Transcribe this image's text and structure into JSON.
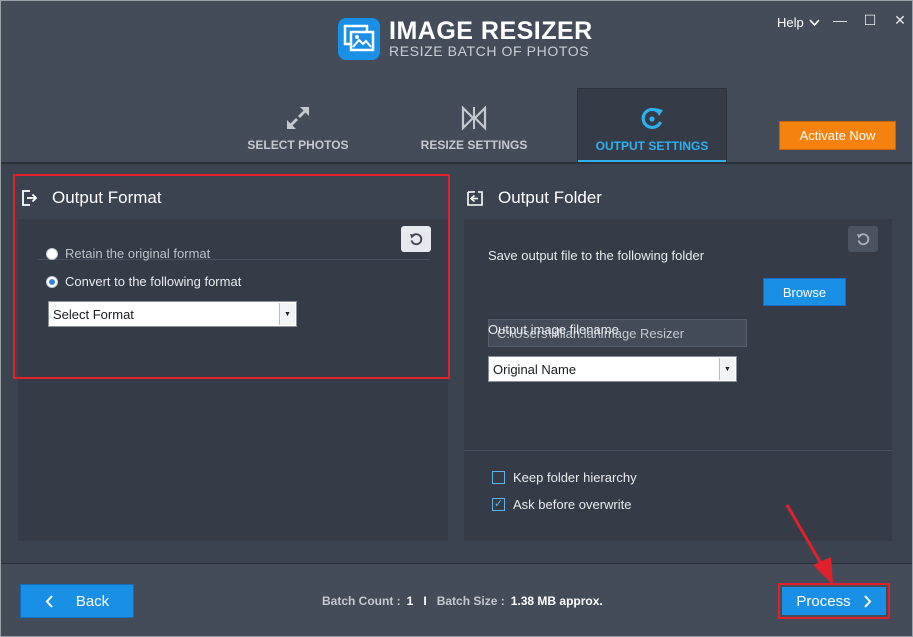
{
  "app": {
    "title": "IMAGE RESIZER",
    "subtitle": "RESIZE BATCH OF PHOTOS"
  },
  "window_controls": {
    "help_label": "Help",
    "minimize_glyph": "—",
    "maximize_glyph": "☐",
    "close_glyph": "✕"
  },
  "tabs": [
    {
      "label": "SELECT PHOTOS",
      "icon": "expand-arrows-icon",
      "active": false
    },
    {
      "label": "RESIZE SETTINGS",
      "icon": "resize-bowtie-icon",
      "active": false
    },
    {
      "label": "OUTPUT SETTINGS",
      "icon": "refresh-circle-icon",
      "active": true
    }
  ],
  "activate_label": "Activate Now",
  "output_format": {
    "title": "Output Format",
    "options": [
      {
        "label": "Retain the original format",
        "selected": false
      },
      {
        "label": "Convert to the following format",
        "selected": true
      }
    ],
    "select_value": "Select Format"
  },
  "output_folder": {
    "title": "Output Folder",
    "save_label": "Save output file to the following folder",
    "path_value": "C:\\Users\\lillian.lai\\Image Resizer",
    "browse_label": "Browse",
    "filename_label": "Output image filename",
    "filename_value": "Original Name",
    "checkboxes": [
      {
        "label": "Keep folder hierarchy",
        "checked": false
      },
      {
        "label": "Ask before overwrite",
        "checked": true
      }
    ]
  },
  "footer": {
    "back_label": "Back",
    "batch_count_label": "Batch Count :",
    "batch_count_value": "1",
    "separator": "I",
    "batch_size_label": "Batch Size :",
    "batch_size_value": "1.38 MB approx.",
    "process_label": "Process"
  },
  "colors": {
    "accent_blue": "#1a8fe6",
    "active_tab": "#2fb0f0",
    "activate_orange": "#f5820f",
    "highlight_red": "#e0202a"
  }
}
